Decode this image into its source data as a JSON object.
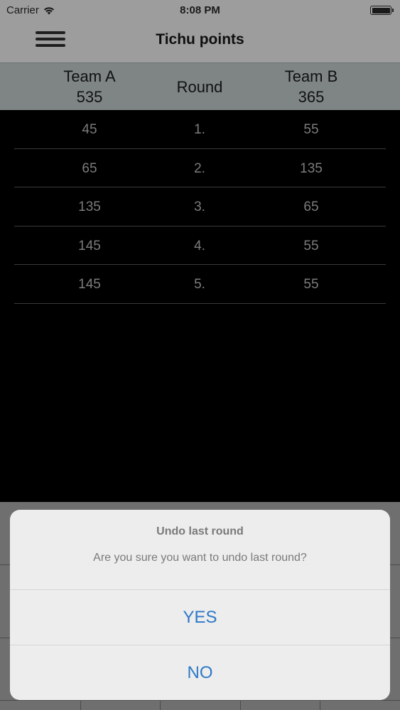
{
  "status_bar": {
    "carrier": "Carrier",
    "wifi_icon": "wifi-icon",
    "time": "8:08 PM",
    "battery_icon": "battery-full-icon"
  },
  "nav": {
    "menu_icon": "hamburger-menu-icon",
    "title": "Tichu points"
  },
  "score_header": {
    "team_a": {
      "name": "Team A",
      "total": "535"
    },
    "round_label": "Round",
    "team_b": {
      "name": "Team B",
      "total": "365"
    }
  },
  "rounds": [
    {
      "a": "45",
      "round": "1.",
      "b": "55"
    },
    {
      "a": "65",
      "round": "2.",
      "b": "135"
    },
    {
      "a": "135",
      "round": "3.",
      "b": "65"
    },
    {
      "a": "145",
      "round": "4.",
      "b": "55"
    },
    {
      "a": "145",
      "round": "5.",
      "b": "55"
    }
  ],
  "alert": {
    "title": "Undo last round",
    "message": "Are you sure you want to undo last round?",
    "yes_label": "YES",
    "no_label": "NO"
  },
  "colors": {
    "accent": "#2f78c7",
    "header_bg": "#7e8584",
    "background": "#000000"
  }
}
